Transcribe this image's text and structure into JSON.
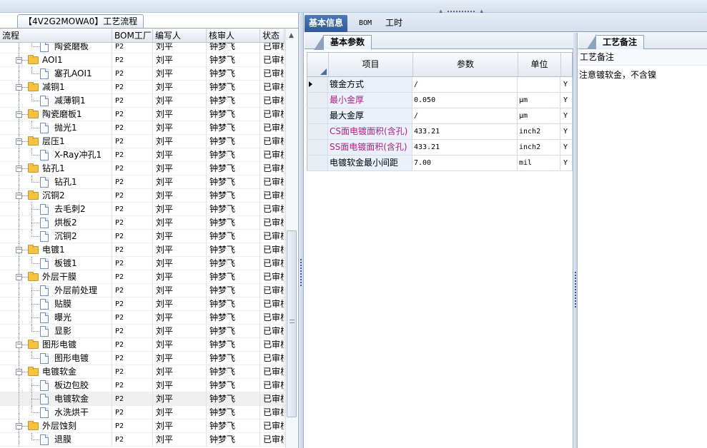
{
  "left_panel": {
    "tab_label": "【4V2G2MOWA0】工艺流程",
    "columns": [
      "流程",
      "BOM工厂",
      "编写人",
      "核审人",
      "状态"
    ],
    "rows": [
      {
        "label": "陶瓷磨板",
        "level": "child",
        "bom": "P2",
        "author": "刘平",
        "reviewer": "钟梦飞",
        "status": "已审核"
      },
      {
        "label": "AOI1",
        "level": "parent",
        "bom": "P2",
        "author": "刘平",
        "reviewer": "钟梦飞",
        "status": "已审核"
      },
      {
        "label": "塞孔AOI1",
        "level": "child",
        "bom": "P2",
        "author": "刘平",
        "reviewer": "钟梦飞",
        "status": "已审核"
      },
      {
        "label": "减铜1",
        "level": "parent",
        "bom": "P2",
        "author": "刘平",
        "reviewer": "钟梦飞",
        "status": "已审核"
      },
      {
        "label": "减薄铜1",
        "level": "child",
        "bom": "P2",
        "author": "刘平",
        "reviewer": "钟梦飞",
        "status": "已审核"
      },
      {
        "label": "陶瓷磨板1",
        "level": "parent",
        "bom": "P2",
        "author": "刘平",
        "reviewer": "钟梦飞",
        "status": "已审核"
      },
      {
        "label": "抛光1",
        "level": "child",
        "bom": "P2",
        "author": "刘平",
        "reviewer": "钟梦飞",
        "status": "已审核"
      },
      {
        "label": "层压1",
        "level": "parent",
        "bom": "P2",
        "author": "刘平",
        "reviewer": "钟梦飞",
        "status": "已审核"
      },
      {
        "label": "X-Ray冲孔1",
        "level": "child",
        "bom": "P2",
        "author": "刘平",
        "reviewer": "钟梦飞",
        "status": "已审核"
      },
      {
        "label": "钻孔1",
        "level": "parent",
        "bom": "P2",
        "author": "刘平",
        "reviewer": "钟梦飞",
        "status": "已审核"
      },
      {
        "label": "钻孔1",
        "level": "child",
        "bom": "P2",
        "author": "刘平",
        "reviewer": "钟梦飞",
        "status": "已审核"
      },
      {
        "label": "沉铜2",
        "level": "parent",
        "bom": "P2",
        "author": "刘平",
        "reviewer": "钟梦飞",
        "status": "已审核"
      },
      {
        "label": "去毛刺2",
        "level": "child",
        "bom": "P2",
        "author": "刘平",
        "reviewer": "钟梦飞",
        "status": "已审核"
      },
      {
        "label": "烘板2",
        "level": "child",
        "bom": "P2",
        "author": "刘平",
        "reviewer": "钟梦飞",
        "status": "已审核"
      },
      {
        "label": "沉铜2",
        "level": "child",
        "bom": "P2",
        "author": "刘平",
        "reviewer": "钟梦飞",
        "status": "已审核"
      },
      {
        "label": "电镀1",
        "level": "parent",
        "bom": "P2",
        "author": "刘平",
        "reviewer": "钟梦飞",
        "status": "已审核"
      },
      {
        "label": "板镀1",
        "level": "child",
        "bom": "P2",
        "author": "刘平",
        "reviewer": "钟梦飞",
        "status": "已审核"
      },
      {
        "label": "外层干膜",
        "level": "parent",
        "bom": "P2",
        "author": "刘平",
        "reviewer": "钟梦飞",
        "status": "已审核"
      },
      {
        "label": "外层前处理",
        "level": "child",
        "bom": "P2",
        "author": "刘平",
        "reviewer": "钟梦飞",
        "status": "已审核"
      },
      {
        "label": "贴膜",
        "level": "child",
        "bom": "P2",
        "author": "刘平",
        "reviewer": "钟梦飞",
        "status": "已审核"
      },
      {
        "label": "曝光",
        "level": "child",
        "bom": "P2",
        "author": "刘平",
        "reviewer": "钟梦飞",
        "status": "已审核"
      },
      {
        "label": "显影",
        "level": "child",
        "bom": "P2",
        "author": "刘平",
        "reviewer": "钟梦飞",
        "status": "已审核"
      },
      {
        "label": "图形电镀",
        "level": "parent",
        "bom": "P2",
        "author": "刘平",
        "reviewer": "钟梦飞",
        "status": "已审核"
      },
      {
        "label": "图形电镀",
        "level": "child",
        "bom": "P2",
        "author": "刘平",
        "reviewer": "钟梦飞",
        "status": "已审核"
      },
      {
        "label": "电镀软金",
        "level": "parent",
        "bom": "P2",
        "author": "刘平",
        "reviewer": "钟梦飞",
        "status": "已审核"
      },
      {
        "label": "板边包胶",
        "level": "child",
        "bom": "P2",
        "author": "刘平",
        "reviewer": "钟梦飞",
        "status": "已审核"
      },
      {
        "label": "电镀软金",
        "level": "child",
        "bom": "P2",
        "author": "刘平",
        "reviewer": "钟梦飞",
        "status": "已审核",
        "selected": true
      },
      {
        "label": "水洗烘干",
        "level": "child",
        "bom": "P2",
        "author": "刘平",
        "reviewer": "钟梦飞",
        "status": "已审核"
      },
      {
        "label": "外层蚀刻",
        "level": "parent",
        "bom": "P2",
        "author": "刘平",
        "reviewer": "钟梦飞",
        "status": "已审核"
      },
      {
        "label": "退膜",
        "level": "child",
        "bom": "P2",
        "author": "刘平",
        "reviewer": "钟梦飞",
        "status": "已审核"
      }
    ]
  },
  "main_tabs": [
    "基本信息",
    "BOM",
    "工时"
  ],
  "params_panel": {
    "tab_label": "基本参数",
    "columns": [
      "项目",
      "参数",
      "单位"
    ],
    "rows": [
      {
        "item": "镀金方式",
        "value": "/",
        "unit": "",
        "flag": "Y",
        "highlight": false,
        "current": true
      },
      {
        "item": "最小金厚",
        "value": "0.050",
        "unit": "μm",
        "flag": "Y",
        "highlight": true
      },
      {
        "item": "最大金厚",
        "value": "/",
        "unit": "μm",
        "flag": "Y",
        "highlight": false
      },
      {
        "item": "CS面电镀面积(含孔)",
        "value": "433.21",
        "unit": "inch2",
        "flag": "Y",
        "highlight": true
      },
      {
        "item": "SS面电镀面积(含孔)",
        "value": "433.21",
        "unit": "inch2",
        "flag": "Y",
        "highlight": true
      },
      {
        "item": "电镀软金最小间距",
        "value": "7.00",
        "unit": "mil",
        "flag": "Y",
        "highlight": false
      }
    ]
  },
  "notes_panel": {
    "tab_label": "工艺备注",
    "label": "工艺备注",
    "text": "注意镀软金，不含镍"
  },
  "colors": {
    "accent": "#2f5b9c",
    "highlight_text": "#b0207e",
    "folder": "#f5c242"
  }
}
